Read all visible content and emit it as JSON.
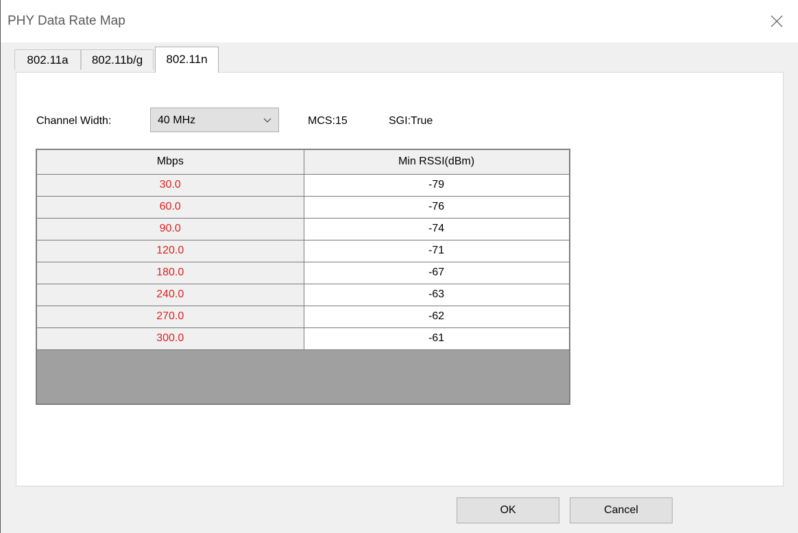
{
  "window": {
    "title": "PHY Data Rate Map"
  },
  "icons": {
    "close": "close-icon",
    "dropdown": "chevron-down-icon"
  },
  "tabs": [
    {
      "label": "802.11a",
      "active": false
    },
    {
      "label": "802.11b/g",
      "active": false
    },
    {
      "label": "802.11n",
      "active": true
    }
  ],
  "settings": {
    "channel_width_label": "Channel Width:",
    "channel_width_value": "40 MHz",
    "mcs_text": "MCS:15",
    "sgi_text": "SGI:True"
  },
  "table": {
    "headers": [
      "Mbps",
      "Min RSSI(dBm)"
    ],
    "rows": [
      {
        "mbps": "30.0",
        "rssi": "-79"
      },
      {
        "mbps": "60.0",
        "rssi": "-76"
      },
      {
        "mbps": "90.0",
        "rssi": "-74"
      },
      {
        "mbps": "120.0",
        "rssi": "-71"
      },
      {
        "mbps": "180.0",
        "rssi": "-67"
      },
      {
        "mbps": "240.0",
        "rssi": "-63"
      },
      {
        "mbps": "270.0",
        "rssi": "-62"
      },
      {
        "mbps": "300.0",
        "rssi": "-61"
      }
    ],
    "rate_color": "#e02020"
  },
  "buttons": {
    "ok_label": "OK",
    "cancel_label": "Cancel"
  }
}
